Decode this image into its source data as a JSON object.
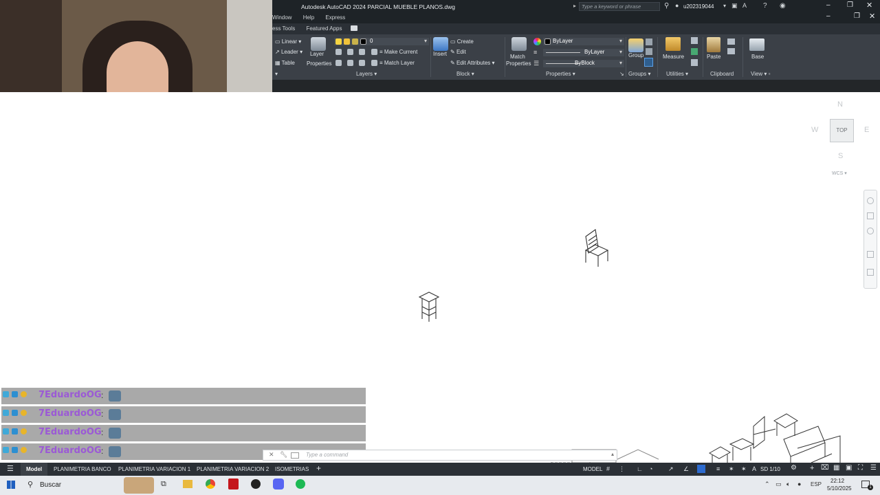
{
  "window": {
    "title": "Autodesk AutoCAD 2024   PARCIAL MUEBLE PLANOS.dwg",
    "search_placeholder": "Type a keyword or phrase",
    "username": "u202319044"
  },
  "menus": [
    "Window",
    "Help",
    "Express"
  ],
  "ribbon_tabs": [
    "ess Tools",
    "Featured Apps"
  ],
  "ribbon": {
    "annotation": {
      "linear": "Linear",
      "leader": "Leader",
      "table": "Table"
    },
    "layers": {
      "layer_properties_1": "Layer",
      "layer_properties_2": "Properties",
      "current_layer": "0",
      "make_current": "Make Current",
      "match_layer": "Match Layer",
      "title": "Layers"
    },
    "block": {
      "insert": "Insert",
      "create": "Create",
      "edit": "Edit",
      "edit_attributes": "Edit Attributes",
      "title": "Block"
    },
    "properties": {
      "match_1": "Match",
      "match_2": "Properties",
      "color": "ByLayer",
      "linetype": "ByLayer",
      "lineweight": "ByBlock",
      "title": "Properties"
    },
    "groups": {
      "group": "Group",
      "title": "Groups"
    },
    "utilities": {
      "measure": "Measure",
      "title": "Utilities"
    },
    "clipboard": {
      "paste": "Paste",
      "title": "Clipboard"
    },
    "view": {
      "base": "Base",
      "title": "View"
    }
  },
  "viewcube": {
    "n": "N",
    "s": "S",
    "e": "E",
    "w": "W",
    "face": "TOP",
    "wcs": "WCS"
  },
  "chat": {
    "rows": [
      {
        "name": "7EduardoOG",
        "sep": ":"
      },
      {
        "name": "7EduardoOG",
        "sep": ":"
      },
      {
        "name": "7EduardoOG",
        "sep": ":"
      },
      {
        "name": "7EduardoOG",
        "sep": ":"
      }
    ]
  },
  "command_line": {
    "placeholder": "Type a command"
  },
  "layout_tabs": [
    "Model",
    "PLANIMETRIA BANCO",
    "PLANIMETRIA VARIACION 1",
    "PLANIMETRIA VARIACION 2",
    "ISOMETRIAS"
  ],
  "status_bar": {
    "model": "MODEL",
    "scale": "SD 1/10"
  },
  "taskbar": {
    "search": "Buscar",
    "language": "ESP",
    "time": "22:12",
    "date": "5/10/2025",
    "notification_count": "1"
  },
  "colors": {
    "accent": "#2d6bcf",
    "ribbon_bg": "#3b4047",
    "title_bg": "#1e2327",
    "chat_name": "#9b59d6"
  }
}
